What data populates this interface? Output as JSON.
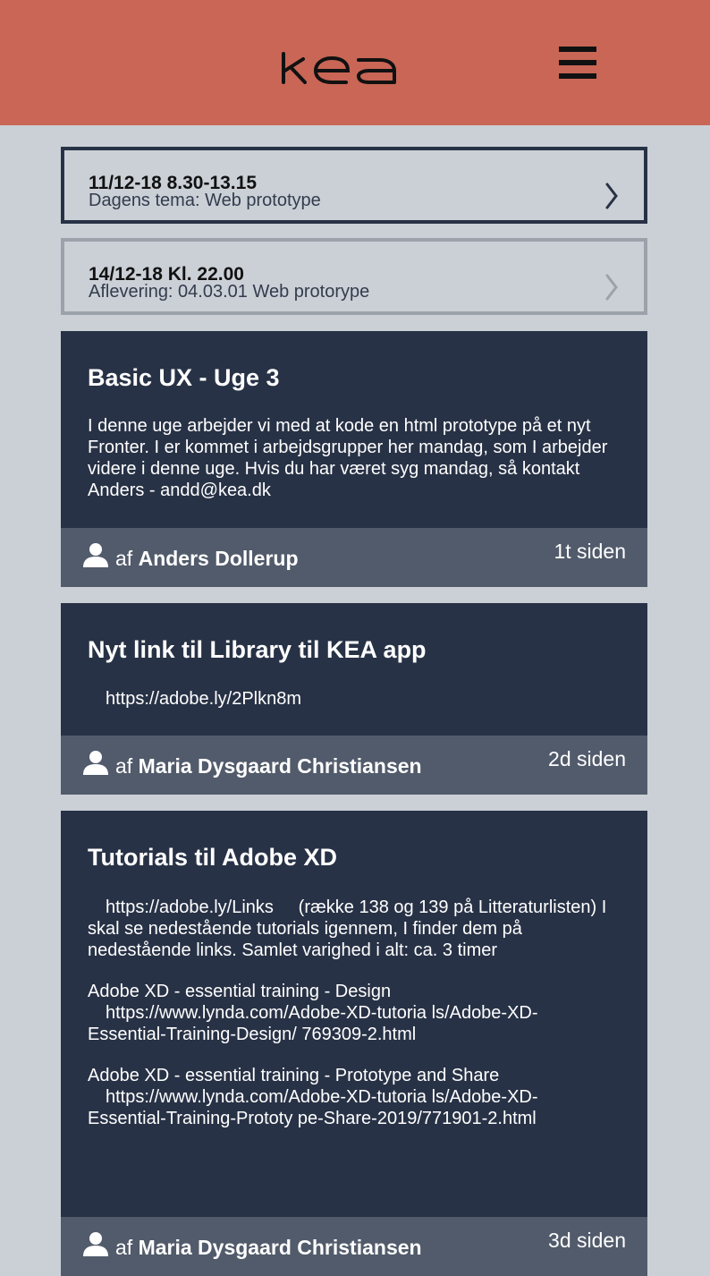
{
  "header": {
    "logo_text": "KEA",
    "menu_icon": "hamburger-menu-icon",
    "background_color": "#c96656"
  },
  "schedule": [
    {
      "date": "11/12-18 8.30-13.15",
      "subtitle": "Dagens tema: Web prototype",
      "state": "active"
    },
    {
      "date": "14/12-18 Kl. 22.00",
      "subtitle": "Aflevering: 04.03.01 Web protorype",
      "state": "inactive"
    }
  ],
  "posts": [
    {
      "title": "Basic UX - Uge 3",
      "body": [
        {
          "text": "I denne uge arbejder vi med at kode en html prototype på et nyt Fronter. I er kommet i arbejdsgrupper her mandag, som I arbejder videre i denne uge. Hvis du har været syg mandag, så kontakt Anders - andd@kea.dk"
        }
      ],
      "by_prefix": "af",
      "author": "Anders Dollerup",
      "time_ago": "1t siden"
    },
    {
      "title": "Nyt link til Library til KEA app",
      "body": [
        {
          "text": "https://adobe.ly/2Plkn8m"
        }
      ],
      "by_prefix": "af",
      "author": "Maria Dysgaard Christiansen",
      "time_ago": "2d siden"
    },
    {
      "title": "Tutorials til Adobe XD",
      "body": [
        {
          "link": "https://adobe.ly/Links",
          "text": "     (række 138 og 139 på Litteraturlisten) I skal se nedestående tutorials igennem, I finder dem på nedestående links. Samlet varighed i alt: ca. 3 timer"
        },
        {
          "heading": "Adobe XD - essential training - Design",
          "link": "https://www.lynda.com/Adobe-XD-tutoria ls/Adobe-XD-",
          "text": "Essential-Training-Design/ 769309-2.html"
        },
        {
          "heading": "Adobe XD - essential training - Prototype and Share",
          "link": "https://www.lynda.com/Adobe-XD-tutoria ls/Adobe-XD-",
          "text": "Essential-Training-Prototy pe-Share-2019/771901-2.html"
        }
      ],
      "by_prefix": "af",
      "author": "Maria Dysgaard Christiansen",
      "time_ago": "3d siden"
    }
  ],
  "colors": {
    "page_bg": "#cbd0d7",
    "card_bg": "#283246",
    "card_footer_bg": "#525b6b"
  }
}
